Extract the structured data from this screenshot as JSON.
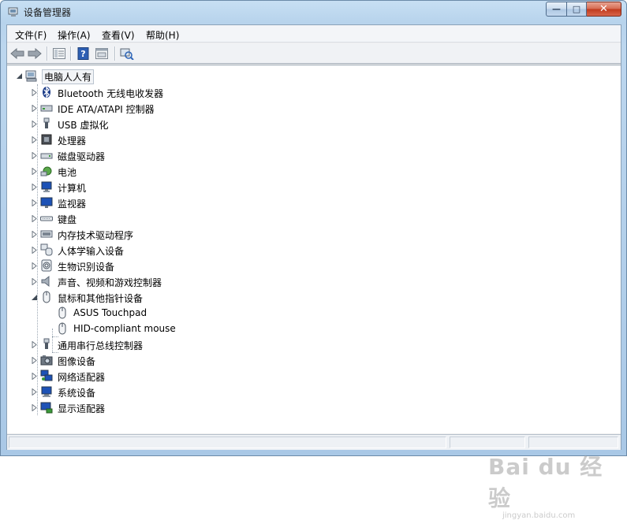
{
  "window": {
    "title": "设备管理器",
    "min_label": "—",
    "max_label": "□",
    "close_label": "✕"
  },
  "menu": [
    {
      "label": "文件(F)"
    },
    {
      "label": "操作(A)"
    },
    {
      "label": "查看(V)"
    },
    {
      "label": "帮助(H)"
    }
  ],
  "toolbar": {
    "buttons": [
      "back-arrow-icon",
      "forward-arrow-icon",
      "properties-view-icon",
      "help-icon",
      "console-view-icon",
      "scan-hardware-icon"
    ]
  },
  "tree": {
    "root": {
      "label": "电脑人人有",
      "icon": "computer-icon"
    },
    "items": [
      {
        "label": "Bluetooth 无线电收发器",
        "icon": "bluetooth-icon"
      },
      {
        "label": "IDE ATA/ATAPI 控制器",
        "icon": "ide-controller-icon"
      },
      {
        "label": "USB 虚拟化",
        "icon": "usb-icon"
      },
      {
        "label": "处理器",
        "icon": "processor-icon"
      },
      {
        "label": "磁盘驱动器",
        "icon": "disk-drive-icon"
      },
      {
        "label": "电池",
        "icon": "battery-icon"
      },
      {
        "label": "计算机",
        "icon": "computer-monitor-icon"
      },
      {
        "label": "监视器",
        "icon": "monitor-icon"
      },
      {
        "label": "键盘",
        "icon": "keyboard-icon"
      },
      {
        "label": "内存技术驱动程序",
        "icon": "memory-icon"
      },
      {
        "label": "人体学输入设备",
        "icon": "hid-icon"
      },
      {
        "label": "生物识别设备",
        "icon": "fingerprint-icon"
      },
      {
        "label": "声音、视频和游戏控制器",
        "icon": "speaker-icon"
      },
      {
        "label": "鼠标和其他指针设备",
        "icon": "mouse-icon",
        "expanded": true,
        "children": [
          {
            "label": "ASUS Touchpad",
            "icon": "mouse-icon"
          },
          {
            "label": "HID-compliant mouse",
            "icon": "mouse-icon"
          }
        ]
      },
      {
        "label": "通用串行总线控制器",
        "icon": "usb-icon"
      },
      {
        "label": "图像设备",
        "icon": "camera-icon"
      },
      {
        "label": "网络适配器",
        "icon": "network-icon"
      },
      {
        "label": "系统设备",
        "icon": "system-icon"
      },
      {
        "label": "显示适配器",
        "icon": "display-adapter-icon"
      }
    ]
  },
  "watermark": {
    "main": "Bai du 经验",
    "sub": "jingyan.baidu.com"
  },
  "colors": {
    "frame": "#b7d3ec",
    "close": "#c0391c",
    "tree_bg": "#ffffff"
  }
}
